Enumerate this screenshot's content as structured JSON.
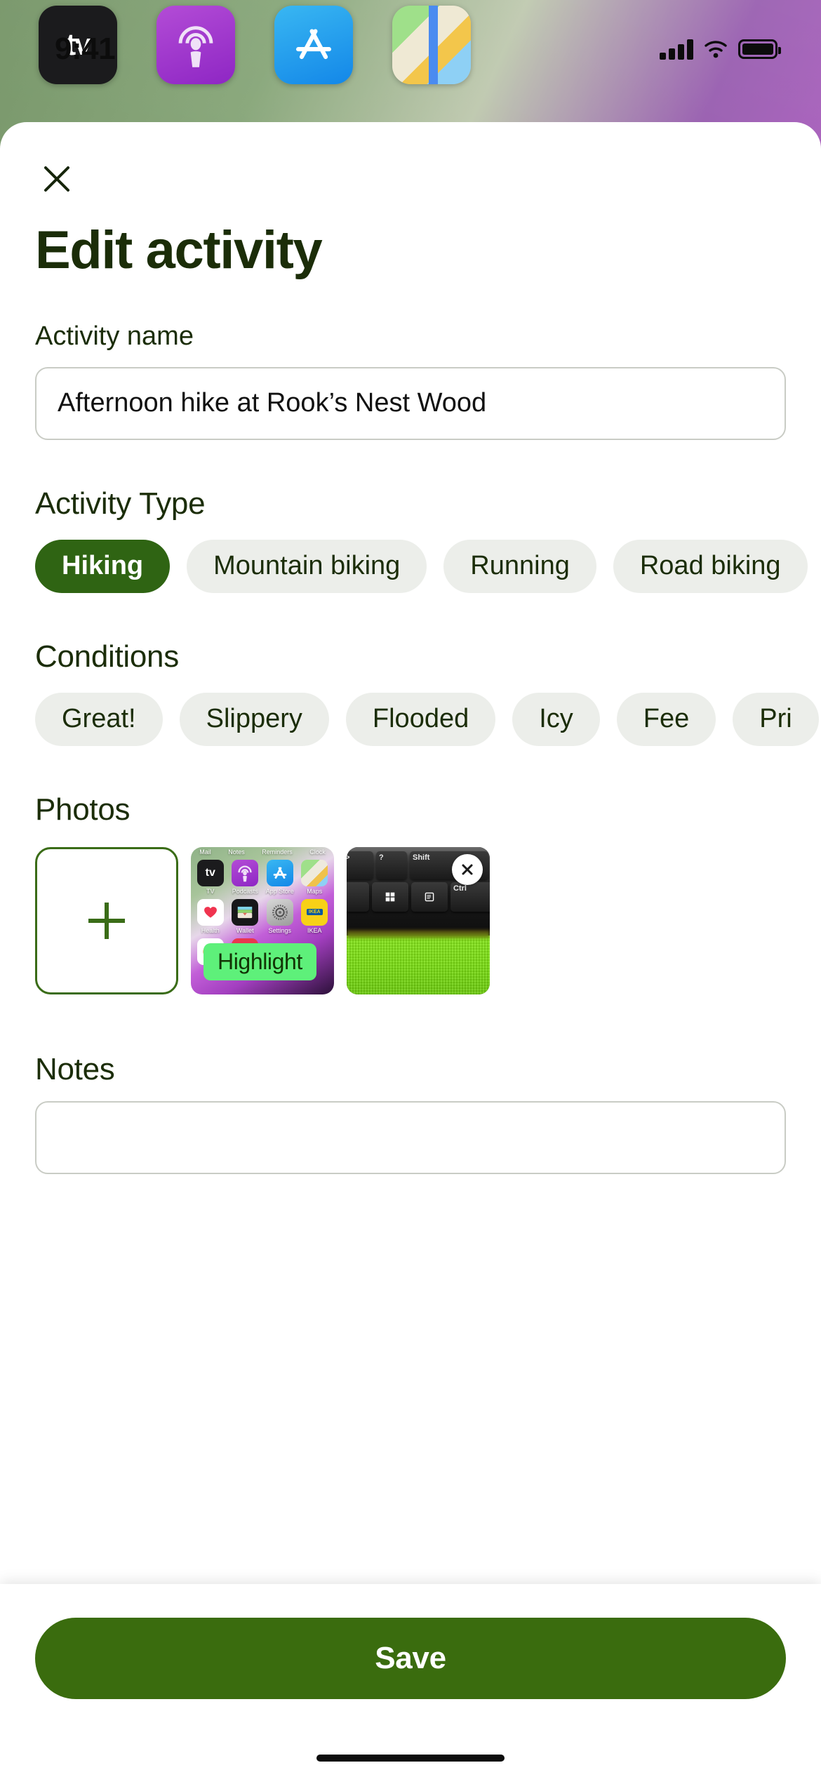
{
  "status_bar": {
    "time": "9:41",
    "signal_icon": "cellular-signal-icon",
    "wifi_icon": "wifi-icon",
    "battery_icon": "battery-icon"
  },
  "home_screen_icons": [
    {
      "name": "apple-tv-app-icon",
      "label": "tv"
    },
    {
      "name": "podcasts-app-icon",
      "label": ""
    },
    {
      "name": "app-store-app-icon",
      "label": ""
    },
    {
      "name": "maps-app-icon",
      "label": ""
    }
  ],
  "sheet": {
    "close_label": "×",
    "title": "Edit activity",
    "activity_name": {
      "label": "Activity name",
      "value": "Afternoon hike at Rook’s Nest Wood",
      "placeholder": "Activity name"
    },
    "activity_type": {
      "label": "Activity Type",
      "selected": "Hiking",
      "options": [
        {
          "label": "Hiking",
          "selected": true
        },
        {
          "label": "Mountain biking",
          "selected": false
        },
        {
          "label": "Running",
          "selected": false
        },
        {
          "label": "Road biking",
          "selected": false
        }
      ]
    },
    "conditions": {
      "label": "Conditions",
      "options": [
        {
          "label": "Great!",
          "selected": false
        },
        {
          "label": "Slippery",
          "selected": false
        },
        {
          "label": "Flooded",
          "selected": false
        },
        {
          "label": "Icy",
          "selected": false
        },
        {
          "label": "Fee",
          "selected": false
        },
        {
          "label": "Pri",
          "selected": false
        }
      ]
    },
    "photos": {
      "label": "Photos",
      "add_label": "+",
      "items": [
        {
          "type": "home-screen-screenshot",
          "badge": "Highlight",
          "badge_color": "#5ef07a",
          "app_labels_top": [
            "Mail",
            "Notes",
            "Reminders",
            "Clock"
          ],
          "app_labels_row1": [
            "TV",
            "Podcasts",
            "App Store",
            "Maps"
          ],
          "app_labels_row2": [
            "Health",
            "Wallet",
            "Settings",
            "IKEA"
          ],
          "ikea_wordmark": "IKEA",
          "tv_glyph": "tv"
        },
        {
          "type": "keyboard-photo",
          "remove_label": "×",
          "keys": [
            "Shift",
            "Ctrl",
            "?",
            ">"
          ]
        }
      ]
    },
    "notes": {
      "label": "Notes",
      "value": "",
      "placeholder": ""
    }
  },
  "bottom_bar": {
    "save_label": "Save"
  },
  "colors": {
    "brand_dark_green": "#1b2d08",
    "chip_selected_green": "#2f6413",
    "save_button_green": "#3a6c0e",
    "chip_background": "#eceeea",
    "highlight_green": "#5ef07a",
    "add_photo_border": "#3a6c17"
  }
}
